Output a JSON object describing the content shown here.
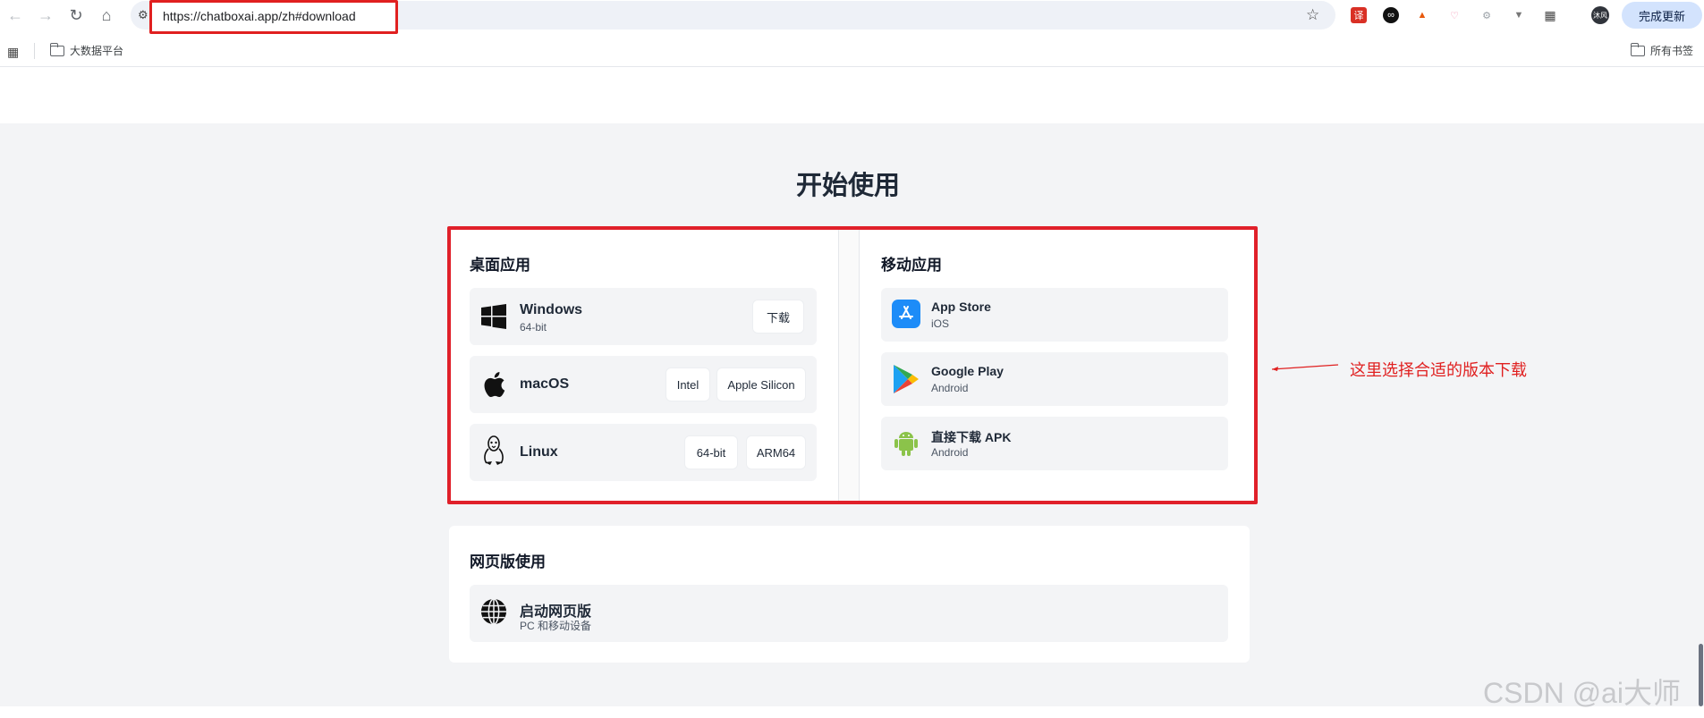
{
  "browser": {
    "url": "https://chatboxai.app/zh#download",
    "update_label": "完成更新",
    "avatar_label": "沐风",
    "bookmarks": {
      "folder": "大数据平台",
      "all": "所有书签"
    }
  },
  "page": {
    "title": "开始使用",
    "desktop": {
      "title": "桌面应用",
      "windows": {
        "label": "Windows",
        "sub": "64-bit",
        "btn": "下载"
      },
      "macos": {
        "label": "macOS",
        "btn_intel": "Intel",
        "btn_silicon": "Apple Silicon"
      },
      "linux": {
        "label": "Linux",
        "btn_64": "64-bit",
        "btn_arm": "ARM64"
      }
    },
    "mobile": {
      "title": "移动应用",
      "appstore": {
        "label": "App Store",
        "sub": "iOS"
      },
      "googleplay": {
        "label": "Google Play",
        "sub": "Android"
      },
      "apk": {
        "label": "直接下载 APK",
        "sub": "Android"
      }
    },
    "web": {
      "title": "网页版使用",
      "launch": {
        "label": "启动网页版",
        "sub": "PC 和移动设备"
      }
    }
  },
  "annotation": "这里选择合适的版本下载",
  "watermark": "CSDN @ai大师",
  "colors": {
    "highlight": "#e0202a",
    "page_bg": "#f3f4f6",
    "android_green": "#8bc34a",
    "appstore_blue": "#1d8cf8"
  }
}
